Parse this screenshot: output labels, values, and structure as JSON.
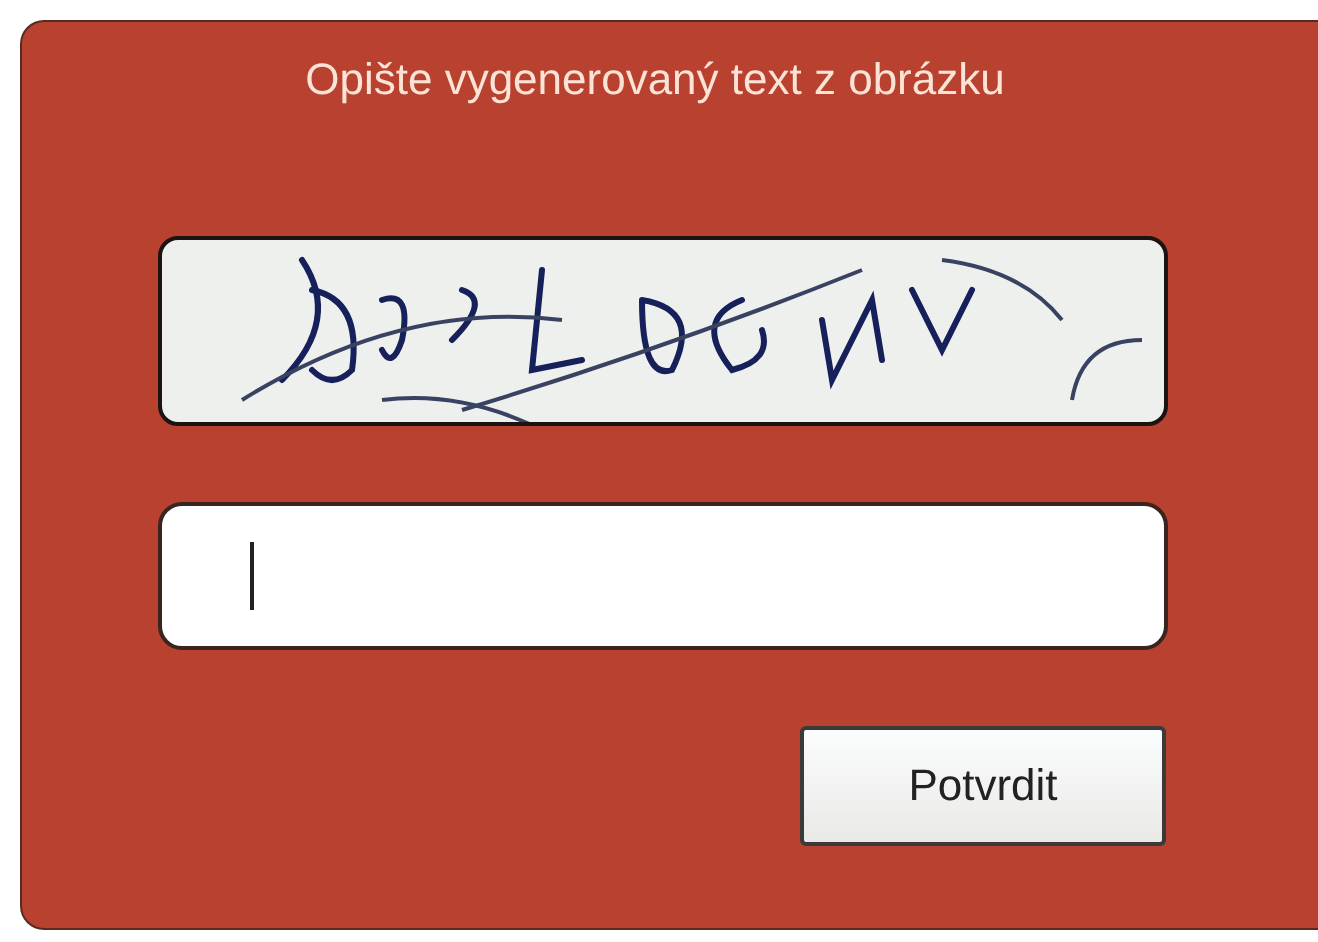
{
  "title": "Opište vygenerovaný text z obrázku",
  "answer": {
    "focused": true
  },
  "button": "Potvrdit"
}
